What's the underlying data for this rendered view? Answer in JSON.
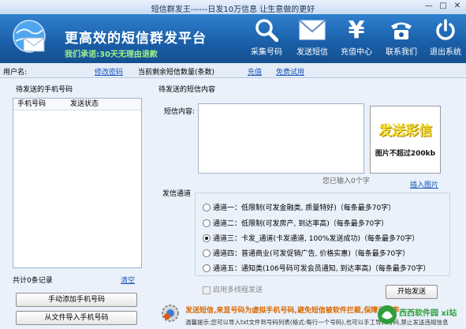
{
  "window": {
    "title": "短信群发王------日发10万信息 让生意做的更好",
    "minimize": "—",
    "maximize": "□",
    "close": "✕"
  },
  "header": {
    "slogan": "更高效的短信群发平台",
    "promise": "我们承诺:30天无理由退款",
    "nav": [
      {
        "label": "采集号码",
        "icon": "search-icon"
      },
      {
        "label": "发送短信",
        "icon": "envelope-icon"
      },
      {
        "label": "充值中心",
        "icon": "yen-icon"
      },
      {
        "label": "联系我们",
        "icon": "telephone-icon"
      },
      {
        "label": "退出系统",
        "icon": "power-icon"
      }
    ]
  },
  "infobar": {
    "username_label": "用户名:",
    "change_password": "修改密码",
    "balance_label": "当前剩余短信数量(条数)",
    "recharge": "充值",
    "free_trial": "免费试用"
  },
  "left_panel": {
    "title": "待发送的手机号码",
    "columns": [
      "手机号码",
      "发送状态"
    ],
    "total_records": "共计0条记录",
    "clear": "清空",
    "manual_add": "手动添加手机号码",
    "import_file": "从文件导入手机号码"
  },
  "right_panel": {
    "title": "待发送的短信内容",
    "content_label": "短信内容:",
    "char_count": "您已输入0个字",
    "image_title": "发送彩信",
    "image_limit": "图片不超过200kb",
    "insert_image": "插入图片",
    "channel_label": "发信通道",
    "channels": [
      {
        "label": "通道一：低限制(可发金融类, 质量特好)（每条最多70字）",
        "selected": false
      },
      {
        "label": "通道二：低限制(可发房产, 到达率高)（每条最多70字）",
        "selected": false
      },
      {
        "label": "通道三：卡发_通道(卡发通道, 100%发送成功)（每条最多70字）",
        "selected": true
      },
      {
        "label": "通道四：普通商业(可发促销广告, 价格实惠)（每条最多70字）",
        "selected": false
      },
      {
        "label": "通道五：通知类(106号码可发会员通知, 到达率高)（每条最多70字）",
        "selected": false
      }
    ],
    "multithread": "启用多线程发送",
    "start_send": "开始发送"
  },
  "footer": {
    "notice": "发送短信,来显号码为虚拟手机号码,避免短信被软件拦截,保障送达率",
    "tip": "温馨提示:您可以导入txt文件到号码列表(格式:每行一个号码),也可以手工导入号码,禁止发送违规信息",
    "watermark": "西西软件园 xi站"
  },
  "colors": {
    "header": "#1a5ea8",
    "accent_green": "#9df28a",
    "link": "#1452b8",
    "mms_yellow": "#f7e63a",
    "footer_orange": "#d86a00"
  }
}
